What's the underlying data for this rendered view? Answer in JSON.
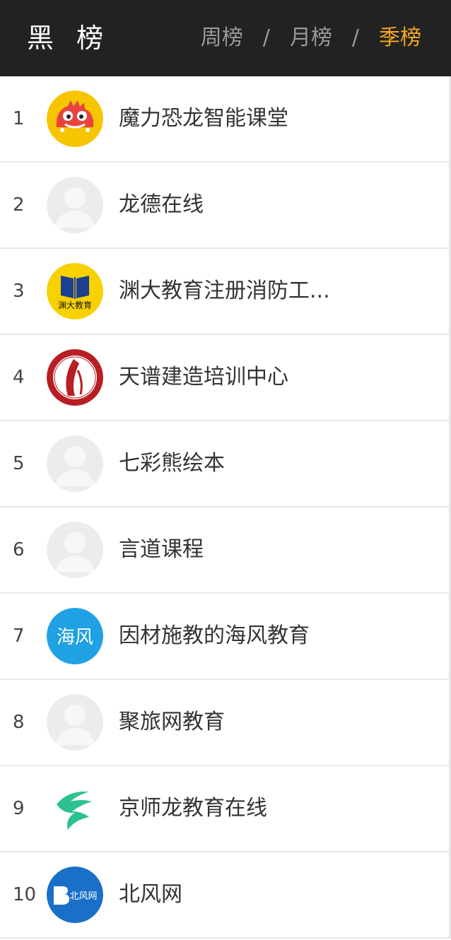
{
  "header": {
    "title": "黑 榜",
    "tabs": [
      {
        "label": "周榜",
        "active": false
      },
      {
        "label": "月榜",
        "active": false
      },
      {
        "label": "季榜",
        "active": true
      }
    ],
    "separator": "/"
  },
  "colors": {
    "header_bg": "#222222",
    "active_tab": "#f5a623",
    "inactive_tab": "#999999"
  },
  "list": [
    {
      "rank": "1",
      "name": "魔力恐龙智能课堂",
      "avatar_icon": "dinosaur-logo-icon"
    },
    {
      "rank": "2",
      "name": "龙德在线",
      "avatar_icon": "default-user-icon"
    },
    {
      "rank": "3",
      "name": "渊大教育注册消防工...",
      "avatar_icon": "book-logo-icon",
      "avatar_text": "渊大教育"
    },
    {
      "rank": "4",
      "name": "天谱建造培训中心",
      "avatar_icon": "red-seal-logo-icon"
    },
    {
      "rank": "5",
      "name": "七彩熊绘本",
      "avatar_icon": "default-user-icon"
    },
    {
      "rank": "6",
      "name": "言道课程",
      "avatar_icon": "default-user-icon"
    },
    {
      "rank": "7",
      "name": "因材施教的海风教育",
      "avatar_icon": "haifeng-logo-icon",
      "avatar_text": "海风"
    },
    {
      "rank": "8",
      "name": "聚旅网教育",
      "avatar_icon": "default-user-icon"
    },
    {
      "rank": "9",
      "name": "京师龙教育在线",
      "avatar_icon": "dragon-logo-icon"
    },
    {
      "rank": "10",
      "name": "北风网",
      "avatar_icon": "beifeng-logo-icon",
      "avatar_text": "北风网"
    }
  ]
}
